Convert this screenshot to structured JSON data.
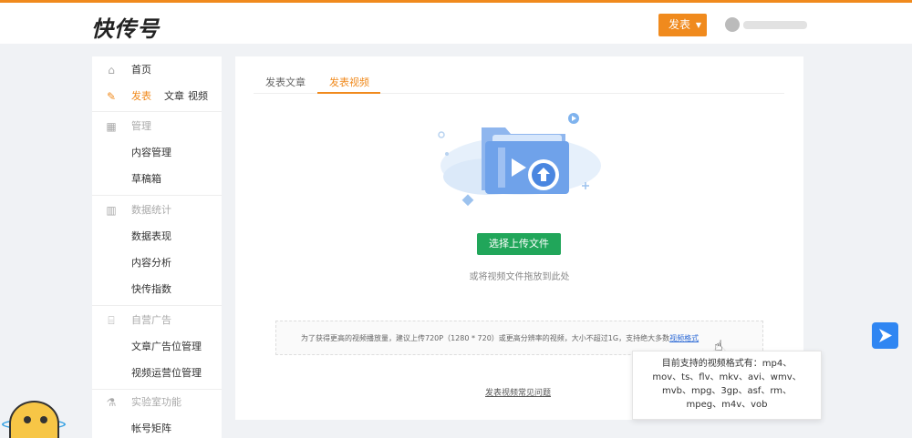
{
  "header": {
    "logo": "快传号",
    "publish_label": "发表",
    "publish_caret": "▼"
  },
  "sidebar": {
    "home": "首页",
    "publish": "发表",
    "publish_article": "文章",
    "publish_video": "视频",
    "manage_section": "管理",
    "content_manage": "内容管理",
    "drafts": "草稿箱",
    "stats_section": "数据统计",
    "data_performance": "数据表现",
    "content_analysis": "内容分析",
    "kuaichuan_index": "快传指数",
    "ads_section": "自营广告",
    "article_ad_manage": "文章广告位管理",
    "video_ad_manage": "视频运营位管理",
    "lab_section": "实验室功能",
    "account_matrix": "帐号矩阵"
  },
  "main": {
    "tabs": [
      {
        "label": "发表文章"
      },
      {
        "label": "发表视频"
      }
    ],
    "upload_button": "选择上传文件",
    "drop_hint": "或将视频文件拖放到此处",
    "notice_text": "为了获得更高的视频播放量，建议上传720P（1280 * 720）或更高分辨率的视频，大小不超过1G，支持绝大多数",
    "notice_link": "视频格式",
    "faq_link": "发表视频常见问题"
  },
  "tooltip": {
    "line1": "目前支持的视频格式有：mp4、",
    "line2": "mov、ts、flv、mkv、avi、wmv、",
    "line3": "mvb、mpg、3gp、asf、rm、",
    "line4": "mpeg、m4v、vob"
  },
  "colors": {
    "accent": "#f08a1d",
    "upload_green": "#21a65a",
    "link_blue": "#2e6bd6"
  }
}
